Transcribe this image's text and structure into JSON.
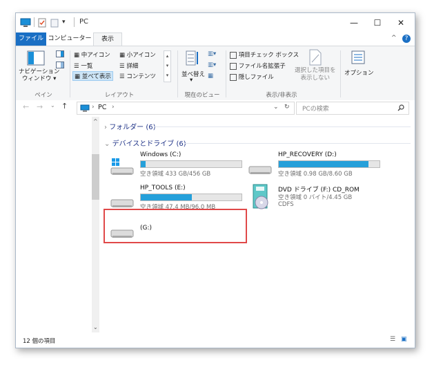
{
  "window": {
    "title": "PC"
  },
  "titlebar": {
    "min": "—",
    "max": "☐",
    "close": "✕"
  },
  "tabs": {
    "file": "ファイル",
    "computer": "コンピューター",
    "view": "表示"
  },
  "ribbon": {
    "nav_pane": "ナビゲーション\nウィンドウ ▾",
    "pane_group": "ペイン",
    "layout": {
      "medium_icons": "中アイコン",
      "small_icons": "小アイコン",
      "list": "一覧",
      "details": "詳細",
      "tiles": "並べて表示",
      "content": "コンテンツ",
      "group": "レイアウト"
    },
    "sort": "並べ替え",
    "current_view_group": "現在のビュー",
    "show": {
      "item_checkboxes": "項目チェック ボックス",
      "file_extensions": "ファイル名拡張子",
      "hidden_items": "隠しファイル",
      "hide_selected": "選択した項目を\n表示しない",
      "group": "表示/非表示"
    },
    "options": "オプション"
  },
  "address": {
    "path": "PC",
    "search_placeholder": "PCの検索"
  },
  "groups": {
    "folders": "フォルダー (6)",
    "devices": "デバイスとドライブ (6)"
  },
  "drives": [
    {
      "name": "Windows (C:)",
      "free": "空き領域 433 GB/456 GB",
      "used_fraction": 0.05
    },
    {
      "name": "HP_RECOVERY (D:)",
      "free": "空き領域 0.98 GB/8.60 GB",
      "used_fraction": 0.89
    },
    {
      "name": "HP_TOOLS (E:)",
      "free": "空き領域 47.4 MB/96.0 MB",
      "used_fraction": 0.51
    },
    {
      "name": "DVD ドライブ (F:) CD_ROM",
      "free": "空き領域 0 バイト/4.45 GB",
      "fs": "CDFS"
    },
    {
      "name": "(G:)"
    }
  ],
  "status": {
    "count": "12 個の項目"
  },
  "colors": {
    "accent": "#1a6fc4",
    "bar_fill": "#26a0da",
    "highlight": "#e04848"
  }
}
